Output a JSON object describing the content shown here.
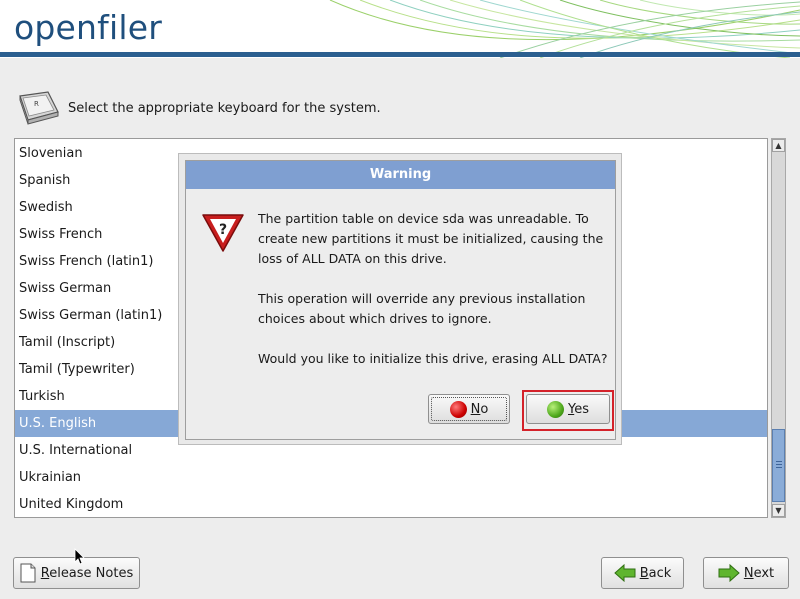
{
  "header": {
    "logo_text": "openfiler",
    "brand_color": "#1f4f7d"
  },
  "prompt": {
    "text": "Select the appropriate keyboard for the system.",
    "icon": "keyboard-key-icon"
  },
  "keyboard_list": {
    "items": [
      "Slovenian",
      "Spanish",
      "Swedish",
      "Swiss French",
      "Swiss French (latin1)",
      "Swiss German",
      "Swiss German (latin1)",
      "Tamil (Inscript)",
      "Tamil (Typewriter)",
      "Turkish",
      "U.S. English",
      "U.S. International",
      "Ukrainian",
      "United Kingdom"
    ],
    "selected": "U.S. English",
    "selected_color": "#86a8d6"
  },
  "dialog": {
    "title": "Warning",
    "icon": "warning-question-icon",
    "paragraph1": "The partition table on device sda was unreadable. To create new partitions it must be initialized, causing the loss of ALL DATA on this drive.",
    "paragraph2": "This operation will override any previous installation choices about which drives to ignore.",
    "paragraph3": "Would you like to initialize this drive, erasing ALL DATA?",
    "no_button": {
      "mnemonic": "N",
      "rest": "o"
    },
    "yes_button": {
      "mnemonic": "Y",
      "rest": "es"
    },
    "highlight_color": "#d4222a"
  },
  "footer": {
    "release_notes": {
      "mnemonic": "R",
      "rest": "elease Notes"
    },
    "back": {
      "mnemonic": "B",
      "rest": "ack"
    },
    "next": {
      "mnemonic": "N",
      "rest": "ext"
    }
  }
}
